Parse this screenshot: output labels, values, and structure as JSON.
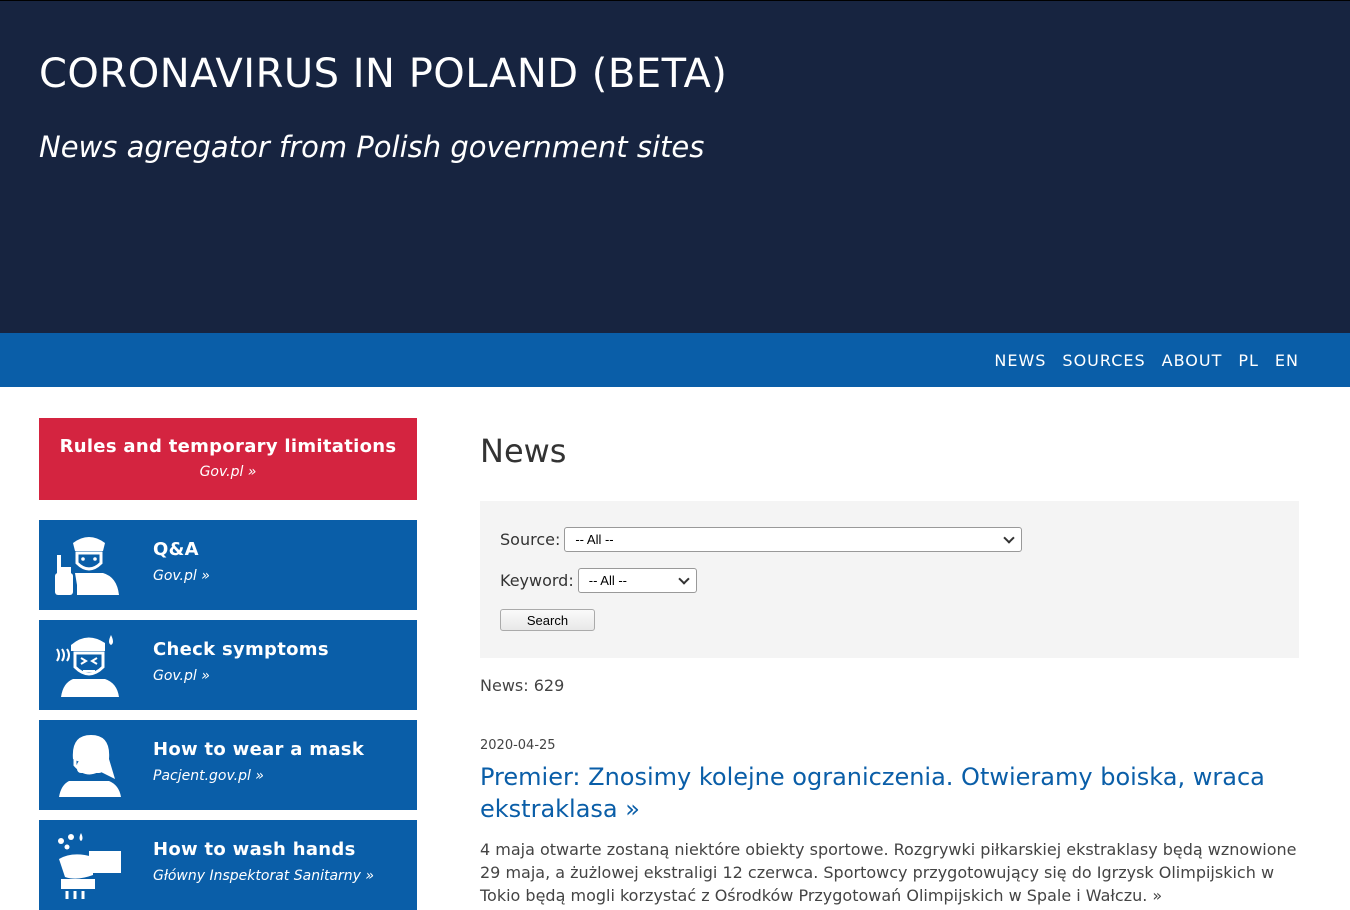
{
  "header": {
    "title": "CORONAVIRUS IN POLAND (BETA)",
    "subtitle": "News agregator from Polish government sites"
  },
  "nav": {
    "items": [
      {
        "label": "NEWS"
      },
      {
        "label": "SOURCES"
      },
      {
        "label": "ABOUT"
      },
      {
        "label": "PL"
      },
      {
        "label": "EN"
      }
    ]
  },
  "sidebar": {
    "featured": {
      "title": "Rules and temporary limitations",
      "link": "Gov.pl »"
    },
    "cards": [
      {
        "title": "Q&A",
        "link": "Gov.pl »",
        "icon": "person-raising-finger-icon"
      },
      {
        "title": "Check symptoms",
        "link": "Gov.pl »",
        "icon": "sick-person-icon"
      },
      {
        "title": "How to wear a mask",
        "link": "Pacjent.gov.pl »",
        "icon": "person-mask-icon"
      },
      {
        "title": "How to wash hands",
        "link": "Główny Inspektorat Sanitarny »",
        "icon": "hand-washing-icon"
      }
    ]
  },
  "main": {
    "title": "News",
    "filters": {
      "source_label": "Source:",
      "source_value": "-- All --",
      "keyword_label": "Keyword:",
      "keyword_value": "-- All --",
      "search_label": "Search"
    },
    "news_count": "News: 629",
    "articles": [
      {
        "date": "2020-04-25",
        "title": "Premier: Znosimy kolejne ograniczenia. Otwieramy boiska, wraca ekstraklasa »",
        "summary": "4 maja otwarte zostaną niektóre obiekty sportowe. Rozgrywki piłkarskiej ekstraklasy będą wznowione 29 maja, a żużlowej ekstraligi 12 czerwca. Sportowcy przygotowujący się do Igrzysk Olimpijskich w Tokio będą mogli korzystać z Ośrodków Przygotowań Olimpijskich w Spale i Wałczu. »"
      }
    ]
  },
  "colors": {
    "header_bg": "#172440",
    "nav_bg": "#0a5ea8",
    "featured_bg": "#d42440",
    "card_bg": "#0a5ea8",
    "link": "#0a5ea8"
  }
}
